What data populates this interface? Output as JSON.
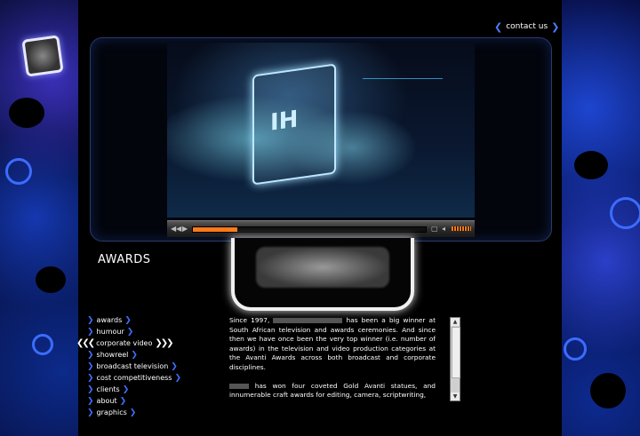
{
  "header": {
    "contact_label": "contact us"
  },
  "video": {
    "overlay_text": "IH",
    "progress_fraction": 0.19
  },
  "section": {
    "title": "AWARDS"
  },
  "nav": {
    "items": [
      {
        "label": "awards",
        "active": false
      },
      {
        "label": "humour",
        "active": false
      },
      {
        "label": "corporate video",
        "active": true
      },
      {
        "label": "showreel",
        "active": false
      },
      {
        "label": "broadcast television",
        "active": false
      },
      {
        "label": "cost competitiveness",
        "active": false
      },
      {
        "label": "clients",
        "active": false
      },
      {
        "label": "about",
        "active": false
      },
      {
        "label": "graphics",
        "active": false
      }
    ]
  },
  "content": {
    "p1_a": "Since 1997,",
    "p1_b": "has been a big winner at South African television and awards ceremonies. And since then we have once been the very top winner (i.e. number of awards) in the television and video production categories at the Avanti Awards across both broadcast and corporate disciplines.",
    "p2": "has won four coveted Gold Avanti statues, and innumerable craft awards for editing, camera, scriptwriting,"
  },
  "colors": {
    "accent_blue": "#3f6fff",
    "progress_orange": "#ff7a1a"
  }
}
